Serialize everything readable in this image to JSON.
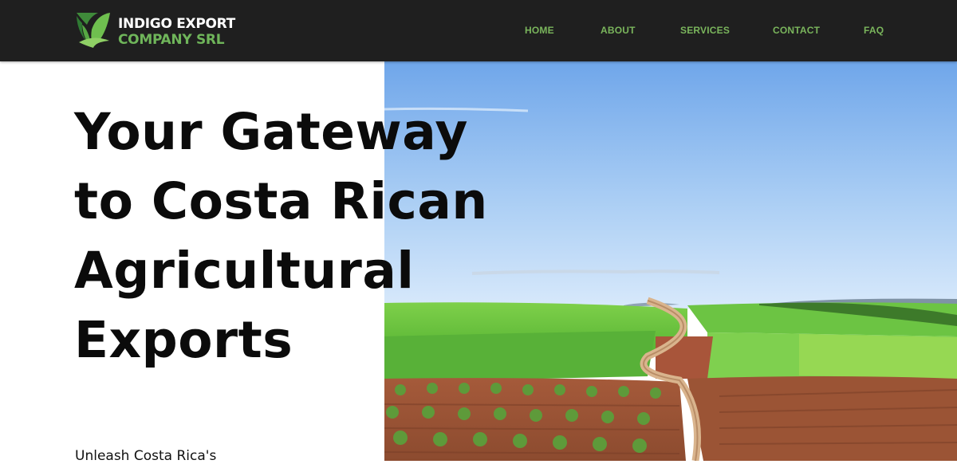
{
  "brand": {
    "line1": "INDIGO EXPORT",
    "line2": "COMPANY SRL",
    "icon": "leaf-logo-icon",
    "accent_color": "#6fb55a"
  },
  "nav": {
    "home": "HOME",
    "about": "ABOUT",
    "services": "SERVICES",
    "contact": "CONTACT",
    "faq": "FAQ"
  },
  "hero": {
    "title_line1": "Your Gateway",
    "title_line2": "to Costa Rican",
    "title_line3": "Agricultural",
    "title_line4": "Exports",
    "subtitle": "Unleash Costa Rica's"
  },
  "colors": {
    "header_bg": "#1f1f1f",
    "nav_text": "#7ab55c"
  }
}
